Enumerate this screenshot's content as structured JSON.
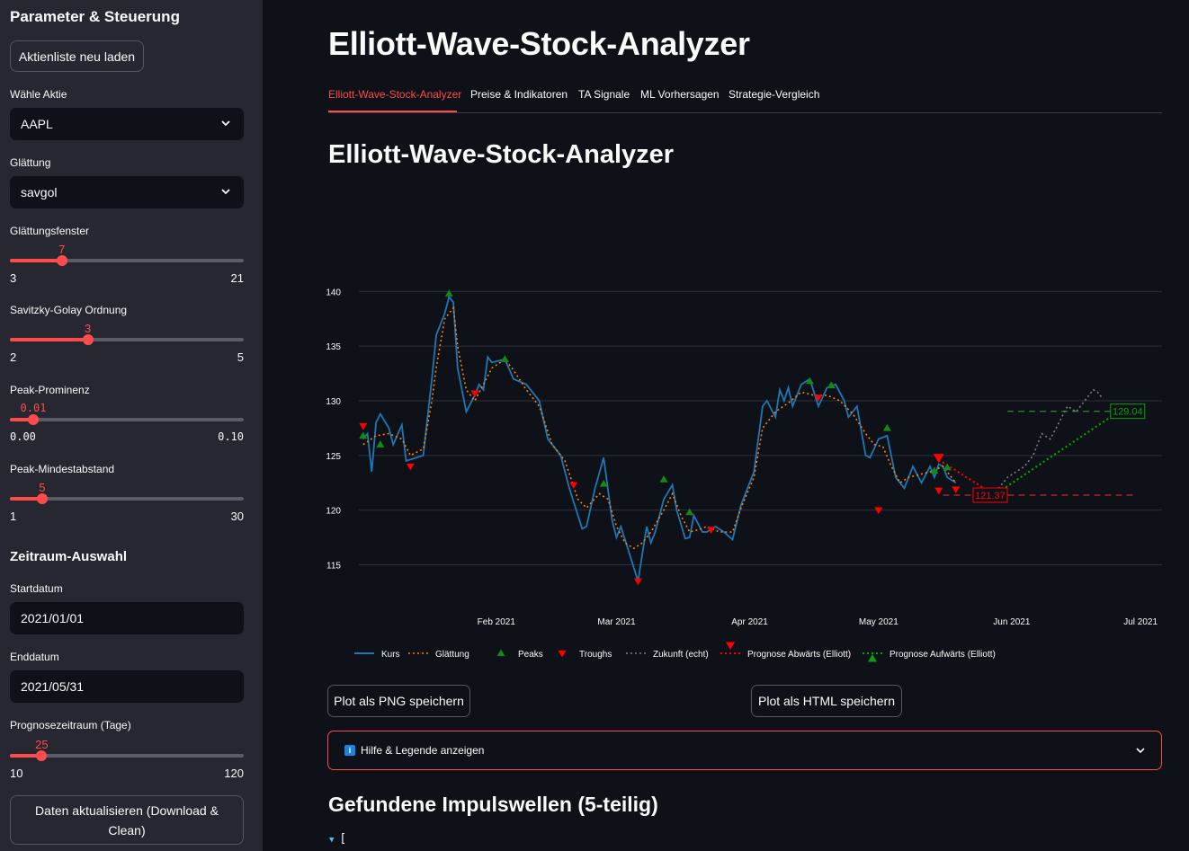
{
  "sidebar": {
    "title": "Parameter & Steuerung",
    "reload_button": "Aktienliste neu laden",
    "stock_label": "Wähle Aktie",
    "stock_value": "AAPL",
    "smoothing_label": "Glättung",
    "smoothing_value": "savgol",
    "window": {
      "label": "Glättungsfenster",
      "value": "7",
      "min": "3",
      "max": "21",
      "fraction": 0.222
    },
    "order": {
      "label": "Savitzky-Golay Ordnung",
      "value": "3",
      "min": "2",
      "max": "5",
      "fraction": 0.333
    },
    "prominence": {
      "label": "Peak-Prominenz",
      "value": "0.01",
      "min": "0.00",
      "max": "0.10",
      "fraction": 0.1
    },
    "distance": {
      "label": "Peak-Mindestabstand",
      "value": "5",
      "min": "1",
      "max": "30",
      "fraction": 0.138
    },
    "range_section": "Zeitraum-Auswahl",
    "start_label": "Startdatum",
    "start_value": "2021/01/01",
    "end_label": "Enddatum",
    "end_value": "2021/05/31",
    "forecast": {
      "label": "Prognosezeitraum (Tage)",
      "value": "25",
      "min": "10",
      "max": "120",
      "fraction": 0.136
    },
    "update_button": "Daten aktualisieren (Download & Clean)"
  },
  "main": {
    "title": "Elliott-Wave-Stock-Analyzer",
    "tabs": [
      "Elliott-Wave-Stock-Analyzer",
      "Preise & Indikatoren",
      "TA Signale",
      "ML Vorhersagen",
      "Strategie-Vergleich"
    ],
    "subtitle": "Elliott-Wave-Stock-Analyzer",
    "png_button": "Plot als PNG speichern",
    "html_button": "Plot als HTML speichern",
    "help_label": "Hilfe & Legende anzeigen",
    "info_icon": "i",
    "impulse_title": "Gefundene Impulswellen (5-teilig)",
    "json_start": "["
  },
  "chart_data": {
    "type": "line",
    "title": "",
    "xlabel": "",
    "ylabel": "",
    "ylim": [
      112,
      142
    ],
    "x_ticks": [
      {
        "label": "Feb 2021",
        "day": 31
      },
      {
        "label": "Mar 2021",
        "day": 59
      },
      {
        "label": "Apr 2021",
        "day": 90
      },
      {
        "label": "May 2021",
        "day": 120
      },
      {
        "label": "Jun 2021",
        "day": 151
      },
      {
        "label": "Jul 2021",
        "day": 181
      }
    ],
    "y_ticks": [
      115,
      120,
      125,
      130,
      135,
      140
    ],
    "x_range_days": [
      -1,
      186
    ],
    "series": [
      {
        "name": "Kurs",
        "color": "#1f77b4",
        "style": "solid",
        "points": [
          [
            0,
            126.5
          ],
          [
            1,
            127.0
          ],
          [
            2,
            123.5
          ],
          [
            3,
            128.0
          ],
          [
            4,
            128.8
          ],
          [
            6,
            127.5
          ],
          [
            7,
            126.0
          ],
          [
            9,
            127.8
          ],
          [
            10,
            124.5
          ],
          [
            14,
            125.0
          ],
          [
            16,
            132.0
          ],
          [
            17,
            136.0
          ],
          [
            19,
            138.0
          ],
          [
            20,
            139.5
          ],
          [
            21,
            139.0
          ],
          [
            22,
            133.0
          ],
          [
            24,
            129.0
          ],
          [
            26,
            130.5
          ],
          [
            27,
            131.5
          ],
          [
            28,
            131.0
          ],
          [
            29,
            134.0
          ],
          [
            30,
            133.5
          ],
          [
            33,
            133.8
          ],
          [
            35,
            132.0
          ],
          [
            38,
            131.5
          ],
          [
            41,
            130.0
          ],
          [
            43,
            126.5
          ],
          [
            46,
            125.0
          ],
          [
            48,
            122.0
          ],
          [
            51,
            118.3
          ],
          [
            52,
            118.5
          ],
          [
            54,
            122.0
          ],
          [
            56,
            124.8
          ],
          [
            58,
            119.0
          ],
          [
            59,
            117.5
          ],
          [
            60,
            118.5
          ],
          [
            62,
            116.0
          ],
          [
            64,
            113.5
          ],
          [
            66,
            118.5
          ],
          [
            67,
            117.0
          ],
          [
            68,
            118.0
          ],
          [
            70,
            121.0
          ],
          [
            72,
            122.3
          ],
          [
            73,
            120.0
          ],
          [
            75,
            117.4
          ],
          [
            76,
            117.5
          ],
          [
            77,
            119.5
          ],
          [
            79,
            118.0
          ],
          [
            80,
            118.0
          ],
          [
            82,
            118.5
          ],
          [
            84,
            118.0
          ],
          [
            86,
            117.3
          ],
          [
            88,
            120.5
          ],
          [
            91,
            123.5
          ],
          [
            93,
            129.5
          ],
          [
            94,
            130.0
          ],
          [
            96,
            128.5
          ],
          [
            97,
            131.0
          ],
          [
            98,
            130.0
          ],
          [
            99,
            131.2
          ],
          [
            100,
            129.5
          ],
          [
            102,
            131.5
          ],
          [
            104,
            132.0
          ],
          [
            106,
            129.5
          ],
          [
            108,
            131.2
          ],
          [
            110,
            131.5
          ],
          [
            112,
            130.0
          ],
          [
            113,
            128.5
          ],
          [
            115,
            129.5
          ],
          [
            117,
            125.0
          ],
          [
            118,
            124.8
          ],
          [
            120,
            126.5
          ],
          [
            122,
            126.8
          ],
          [
            124,
            123.0
          ],
          [
            126,
            122.0
          ],
          [
            128,
            124.0
          ],
          [
            130,
            122.5
          ],
          [
            132,
            124.0
          ],
          [
            133,
            123.0
          ],
          [
            134,
            124.2
          ],
          [
            135,
            124.0
          ],
          [
            136,
            123.0
          ],
          [
            138,
            122.5
          ]
        ]
      },
      {
        "name": "Glättung",
        "color": "#ff7f0e",
        "style": "dotted",
        "points": [
          [
            0,
            126.0
          ],
          [
            3,
            126.8
          ],
          [
            6,
            127.0
          ],
          [
            9,
            126.5
          ],
          [
            11,
            125.0
          ],
          [
            14,
            125.6
          ],
          [
            16,
            130.0
          ],
          [
            17,
            133.0
          ],
          [
            19,
            137.5
          ],
          [
            21,
            138.5
          ],
          [
            22,
            135.0
          ],
          [
            24,
            131.0
          ],
          [
            26,
            130.0
          ],
          [
            28,
            131.5
          ],
          [
            30,
            133.0
          ],
          [
            33,
            133.8
          ],
          [
            35,
            132.8
          ],
          [
            38,
            131.0
          ],
          [
            41,
            129.5
          ],
          [
            44,
            126.0
          ],
          [
            47,
            124.5
          ],
          [
            50,
            121.0
          ],
          [
            52,
            120.2
          ],
          [
            55,
            121.5
          ],
          [
            57,
            121.0
          ],
          [
            59,
            118.5
          ],
          [
            61,
            117.0
          ],
          [
            63,
            116.5
          ],
          [
            65,
            117.0
          ],
          [
            67,
            118.0
          ],
          [
            70,
            120.0
          ],
          [
            72,
            121.5
          ],
          [
            74,
            119.5
          ],
          [
            76,
            118.0
          ],
          [
            78,
            118.2
          ],
          [
            80,
            118.5
          ],
          [
            83,
            118.0
          ],
          [
            86,
            118.0
          ],
          [
            88,
            120.2
          ],
          [
            91,
            123.0
          ],
          [
            93,
            127.5
          ],
          [
            96,
            129.0
          ],
          [
            99,
            129.8
          ],
          [
            102,
            130.8
          ],
          [
            105,
            130.5
          ],
          [
            108,
            130.5
          ],
          [
            111,
            130.0
          ],
          [
            114,
            128.8
          ],
          [
            117,
            127.0
          ],
          [
            119,
            126.0
          ],
          [
            121,
            125.8
          ],
          [
            123,
            124.0
          ],
          [
            125,
            122.5
          ],
          [
            127,
            123.0
          ],
          [
            130,
            123.3
          ],
          [
            132,
            123.5
          ],
          [
            135,
            124.0
          ],
          [
            137,
            123.0
          ],
          [
            138,
            122.5
          ]
        ]
      },
      {
        "name": "Zukunft (echt)",
        "color": "#808080",
        "style": "dotted",
        "points": [
          [
            146,
            121.0
          ],
          [
            148,
            122.0
          ],
          [
            150,
            123.0
          ],
          [
            152,
            123.5
          ],
          [
            154,
            124.0
          ],
          [
            156,
            125.0
          ],
          [
            158,
            127.0
          ],
          [
            160,
            126.5
          ],
          [
            162,
            128.0
          ],
          [
            164,
            129.5
          ],
          [
            166,
            129.0
          ],
          [
            168,
            130.0
          ],
          [
            170,
            131.0
          ],
          [
            171,
            130.8
          ],
          [
            172,
            130.3
          ]
        ]
      },
      {
        "name": "Prognose Abwärts (Elliott)",
        "color": "#ff0000",
        "style": "dotted",
        "points": [
          [
            134,
            124.6
          ],
          [
            147,
            121.4
          ]
        ]
      },
      {
        "name": "Prognose Aufwärts (Elliott)",
        "color": "#0aa00a",
        "style": "dotted",
        "points": [
          [
            147,
            121.4
          ],
          [
            176,
            129.04
          ]
        ]
      }
    ],
    "peaks": [
      [
        0,
        126.8
      ],
      [
        4,
        126.0
      ],
      [
        20,
        139.8
      ],
      [
        33,
        133.8
      ],
      [
        56,
        122.4
      ],
      [
        70,
        122.8
      ],
      [
        76,
        119.8
      ],
      [
        104,
        131.8
      ],
      [
        109,
        131.4
      ],
      [
        122,
        127.5
      ],
      [
        133,
        123.6
      ],
      [
        136,
        123.9
      ]
    ],
    "troughs": [
      [
        0,
        127.7
      ],
      [
        11,
        124.0
      ],
      [
        26,
        130.7
      ],
      [
        49,
        122.3
      ],
      [
        64,
        113.5
      ],
      [
        81,
        118.2
      ],
      [
        106,
        130.3
      ],
      [
        120,
        120.0
      ],
      [
        134,
        121.8
      ],
      [
        138,
        121.9
      ]
    ],
    "forecast_markers": {
      "down": [
        134,
        124.8
      ],
      "up": [
        147,
        121.4
      ]
    },
    "hlines": [
      {
        "y": 129.04,
        "from": 150,
        "to": 180,
        "color": "#2e7d32"
      },
      {
        "y": 121.37,
        "from": 135,
        "to": 180,
        "color": "#c62828"
      }
    ],
    "annotations": [
      {
        "text": "129.04",
        "x": 178,
        "y": 129.04,
        "color": "#0aa00a"
      },
      {
        "text": "121.37",
        "x": 146,
        "y": 121.37,
        "color": "#ff0000"
      }
    ],
    "legend": [
      "Kurs",
      "Glättung",
      "Peaks",
      "Troughs",
      "Zukunft (echt)",
      "Prognose Abwärts (Elliott)",
      "Prognose Aufwärts (Elliott)"
    ],
    "legend_position": "bottom",
    "grid": true
  }
}
